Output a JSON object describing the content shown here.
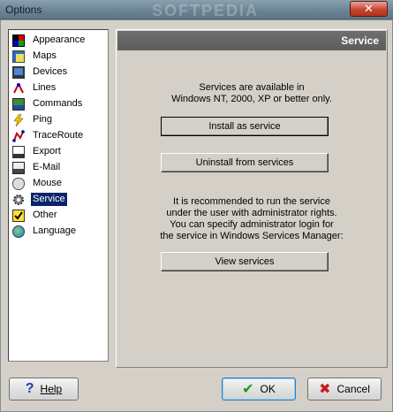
{
  "window": {
    "title": "Options",
    "close_glyph": "✕"
  },
  "watermark": "SOFTPEDIA",
  "tree": {
    "items": [
      {
        "label": "Appearance",
        "icon": "appearance-icon",
        "selected": false
      },
      {
        "label": "Maps",
        "icon": "map-icon",
        "selected": false
      },
      {
        "label": "Devices",
        "icon": "devices-icon",
        "selected": false
      },
      {
        "label": "Lines",
        "icon": "lines-icon",
        "selected": false
      },
      {
        "label": "Commands",
        "icon": "commands-icon",
        "selected": false
      },
      {
        "label": "Ping",
        "icon": "ping-icon",
        "selected": false
      },
      {
        "label": "TraceRoute",
        "icon": "traceroute-icon",
        "selected": false
      },
      {
        "label": "Export",
        "icon": "export-icon",
        "selected": false
      },
      {
        "label": "E-Mail",
        "icon": "email-icon",
        "selected": false
      },
      {
        "label": "Mouse",
        "icon": "mouse-icon",
        "selected": false
      },
      {
        "label": "Service",
        "icon": "service-gear-icon",
        "selected": true
      },
      {
        "label": "Other",
        "icon": "other-check-icon",
        "selected": false
      },
      {
        "label": "Language",
        "icon": "globe-icon",
        "selected": false
      }
    ]
  },
  "panel": {
    "header": "Service",
    "notice_line1": "Services are available in",
    "notice_line2": "Windows NT, 2000, XP or better only.",
    "install_label": "Install as service",
    "uninstall_label": "Uninstall from services",
    "rec_line1": "It is recommended to run the service",
    "rec_line2": "under the user with administrator rights.",
    "rec_line3": "You can specify administrator login for",
    "rec_line4": "the service in Windows Services Manager:",
    "view_label": "View services"
  },
  "buttons": {
    "help_label": "Help",
    "ok_label": "OK",
    "cancel_label": "Cancel"
  },
  "colors": {
    "selection": "#0a246a",
    "ok_check": "#1a9a1a",
    "cancel_x": "#cc1a1a"
  }
}
